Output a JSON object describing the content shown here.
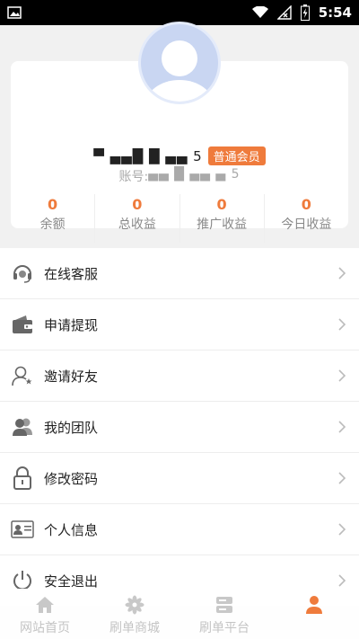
{
  "status_bar": {
    "time": "5:54",
    "icons": [
      "image-icon",
      "wifi-icon",
      "signal-off-icon",
      "battery-charging-icon"
    ]
  },
  "profile": {
    "name": "▀ ▄▄█ █ ▄▄ 5",
    "member_badge": "普通会员",
    "account_label": "账号:",
    "account_value": "▄▄ █ ▄▄ ▄ 5",
    "stats": [
      {
        "value": "0",
        "label": "余额"
      },
      {
        "value": "0",
        "label": "总收益"
      },
      {
        "value": "0",
        "label": "推广收益"
      },
      {
        "value": "0",
        "label": "今日收益"
      }
    ],
    "accent": "#ef7b3c"
  },
  "menu": [
    {
      "label": "在线客服",
      "icon": "headset-icon"
    },
    {
      "label": "申请提现",
      "icon": "wallet-icon"
    },
    {
      "label": "邀请好友",
      "icon": "invite-user-icon"
    },
    {
      "label": "我的团队",
      "icon": "team-icon"
    },
    {
      "label": "修改密码",
      "icon": "lock-icon"
    },
    {
      "label": "个人信息",
      "icon": "id-card-icon"
    },
    {
      "label": "安全退出",
      "icon": "power-icon"
    }
  ],
  "tabbar": [
    {
      "label": "网站首页",
      "icon": "home-icon"
    },
    {
      "label": "刷单商城",
      "icon": "flower-icon"
    },
    {
      "label": "刷单平台",
      "icon": "server-icon"
    },
    {
      "label": "",
      "icon": "user-icon",
      "active": true
    }
  ]
}
